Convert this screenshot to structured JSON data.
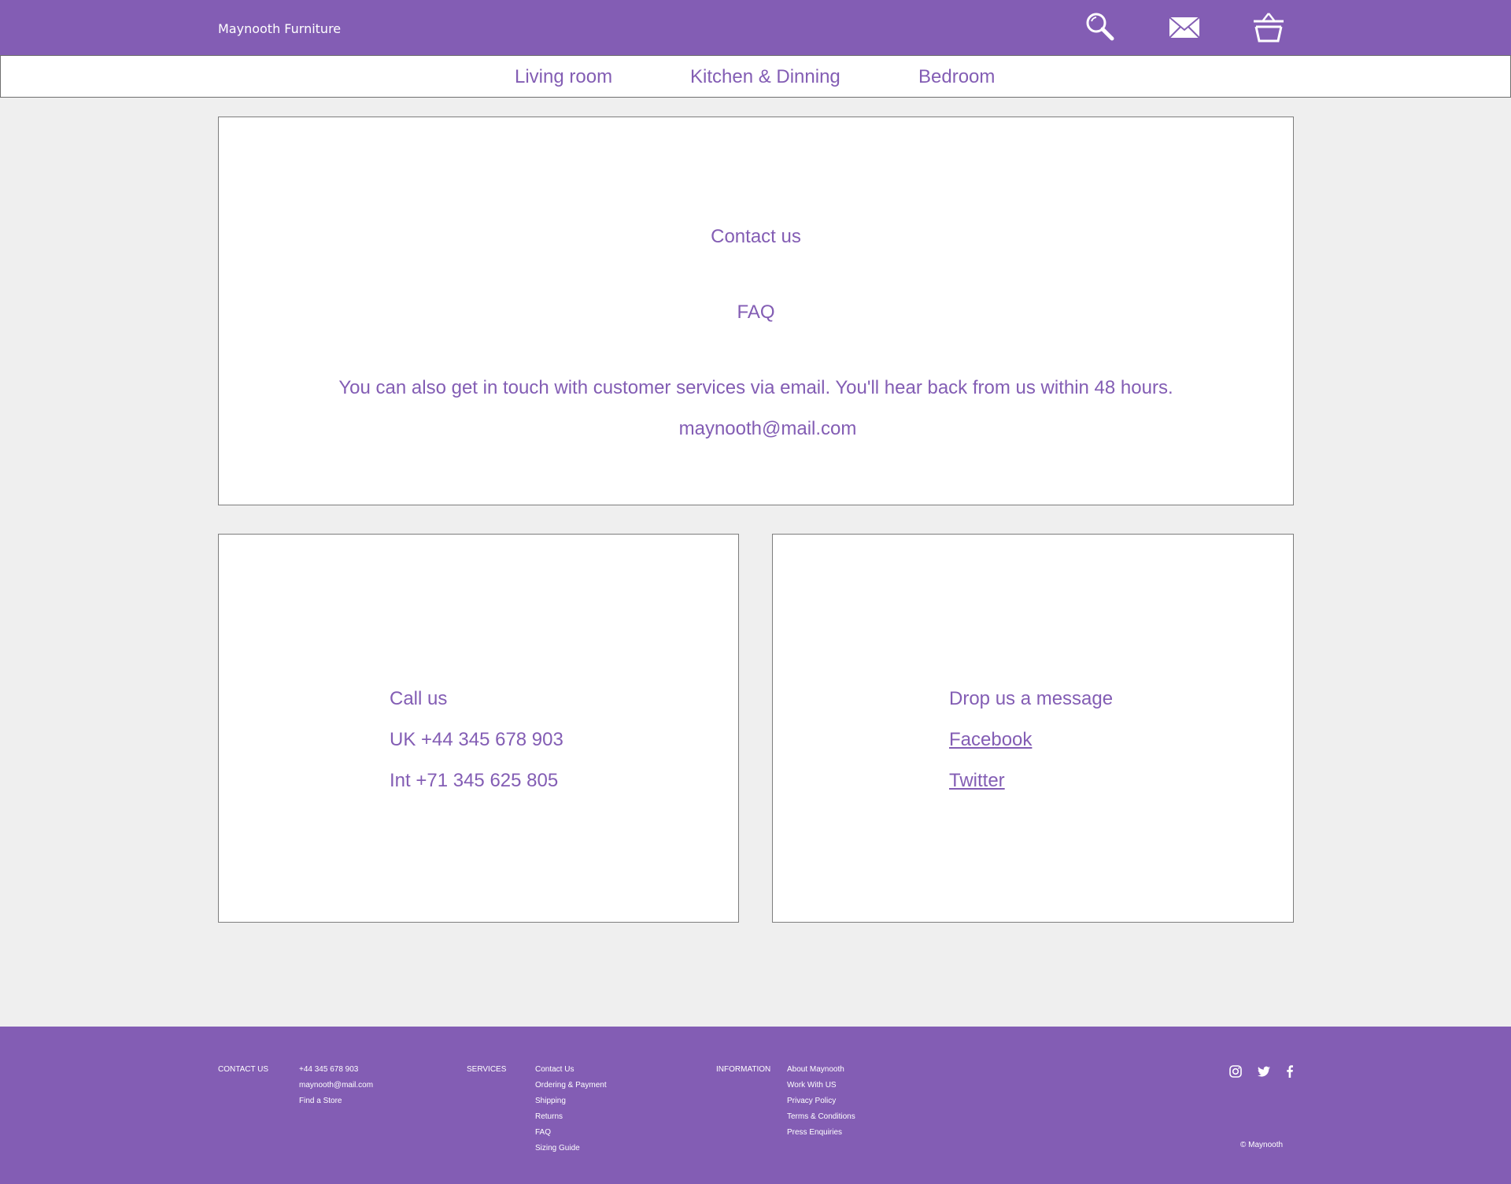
{
  "header": {
    "brand": "Maynooth Furniture",
    "icons": [
      "search-icon",
      "mail-icon",
      "basket-icon"
    ]
  },
  "nav": {
    "items": [
      {
        "label": "Living room"
      },
      {
        "label": "Kitchen & Dinning"
      },
      {
        "label": "Bedroom"
      }
    ]
  },
  "contact": {
    "heading": "Contact us",
    "faq_label": "FAQ",
    "email_note": "You can also get in touch with customer services via email. You'll hear back from us within 48 hours.",
    "email": "maynooth@mail.com"
  },
  "call": {
    "heading": "Call us",
    "uk": "UK +44 345 678 903",
    "intl": "Int +71 345 625 805"
  },
  "message": {
    "heading": "Drop us a message",
    "links": [
      {
        "label": "Facebook"
      },
      {
        "label": "Twitter"
      }
    ]
  },
  "footer": {
    "contact": {
      "heading": "CONTACT US",
      "items": [
        "+44 345 678 903",
        "maynooth@mail.com",
        "Find a Store"
      ]
    },
    "services": {
      "heading": "SERVICES",
      "items": [
        "Contact Us",
        "Ordering & Payment",
        "Shipping",
        "Returns",
        "FAQ",
        "Sizing Guide"
      ]
    },
    "information": {
      "heading": "INFORMATION",
      "items": [
        "About Maynooth",
        "Work With US",
        "Privacy Policy",
        "Terms & Conditions",
        "Press Enquiries"
      ]
    },
    "social_icons": [
      "instagram-icon",
      "twitter-icon",
      "facebook-icon"
    ],
    "copyright": "© Maynooth"
  },
  "colors": {
    "brand_purple": "#835db4",
    "background": "#efefef",
    "panel": "#ffffff"
  }
}
